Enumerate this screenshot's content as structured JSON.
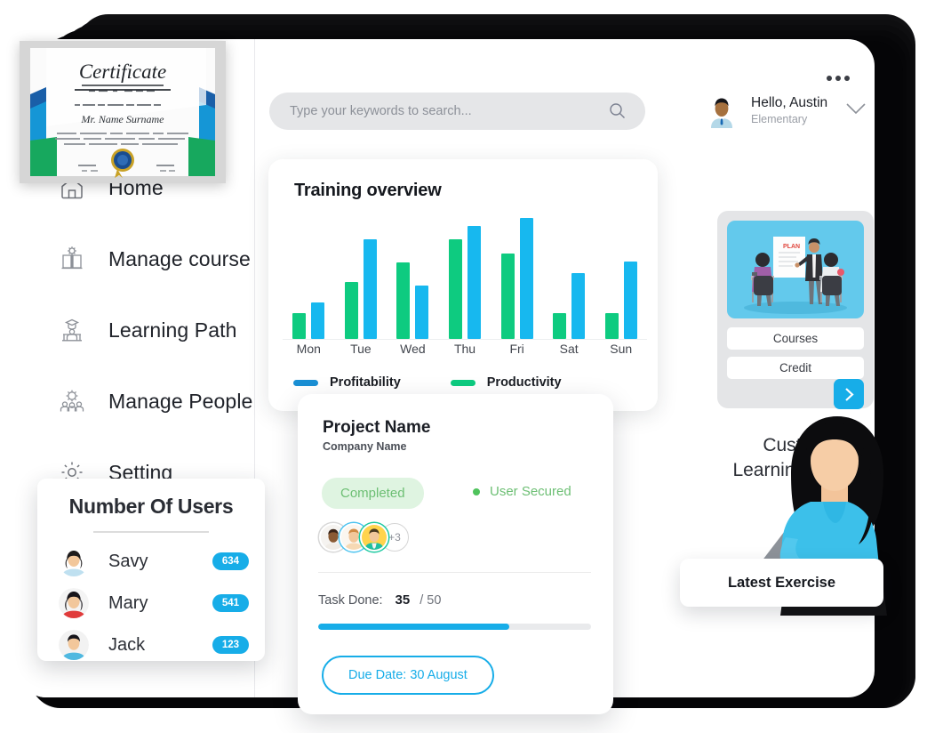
{
  "header": {
    "search": {
      "placeholder": "Type your keywords to search...",
      "value": ""
    },
    "search_icon": "search-icon",
    "profile": {
      "greeting": "Hello, Austin",
      "role": "Elementary"
    },
    "more_icon": "more-options-icon",
    "chevron_icon": "chevron-down-icon"
  },
  "sidebar": {
    "items": [
      {
        "label": "Home",
        "icon": "home-icon"
      },
      {
        "label": "Manage course",
        "icon": "book-gear-icon"
      },
      {
        "label": "Learning Path",
        "icon": "graduate-desk-icon"
      },
      {
        "label": "Manage People",
        "icon": "people-gear-icon"
      },
      {
        "label": "Setting",
        "icon": "gear-icon"
      }
    ]
  },
  "chart_data": {
    "type": "bar",
    "title": "Training overview",
    "categories": [
      "Mon",
      "Tue",
      "Wed",
      "Thu",
      "Fri",
      "Sat",
      "Sun"
    ],
    "series": [
      {
        "name": "Productivity",
        "color": "#0ecb80",
        "values": [
          20,
          45,
          60,
          78,
          67,
          20,
          20
        ]
      },
      {
        "name": "Profitability",
        "color": "#17b8ef",
        "values": [
          29,
          78,
          42,
          89,
          95,
          52,
          61
        ]
      }
    ],
    "legend": [
      {
        "label": "Profitability",
        "color": "#1a8fd4"
      },
      {
        "label": "Productivity",
        "color": "#0ecb80"
      }
    ],
    "ylim": [
      0,
      100
    ],
    "grid": false,
    "legend_position": "bottom-left",
    "xlabel": "",
    "ylabel": ""
  },
  "project": {
    "name": "Project Name",
    "company": "Company Name",
    "status_badge": "Completed",
    "secured_label": "User Secured",
    "avatars_overflow": "+3",
    "task_label": "Task Done:",
    "task_done": "35",
    "task_total": "/ 50",
    "progress_percent": 70,
    "due_button": "Due Date: 30 August"
  },
  "promo": {
    "buttons": [
      "Courses",
      "Credit"
    ],
    "next_icon": "chevron-right-icon",
    "caption": "Custom\nLearning Soluti",
    "caption_line1": "Custom",
    "caption_line2": "Learning Soluti"
  },
  "users_card": {
    "title": "Number Of Users",
    "rows": [
      {
        "name": "Savy",
        "count": "634"
      },
      {
        "name": "Mary",
        "count": "541"
      },
      {
        "name": "Jack",
        "count": "123"
      }
    ]
  },
  "latest_exercise": {
    "label": "Latest Exercise"
  },
  "certificate": {
    "title": "Certificate"
  },
  "colors": {
    "accent_blue": "#17ade8",
    "bar_blue": "#17b8ef",
    "bar_green": "#0ecb80",
    "status_green": "#6dbf74",
    "badge_bg": "#dff4e1"
  }
}
